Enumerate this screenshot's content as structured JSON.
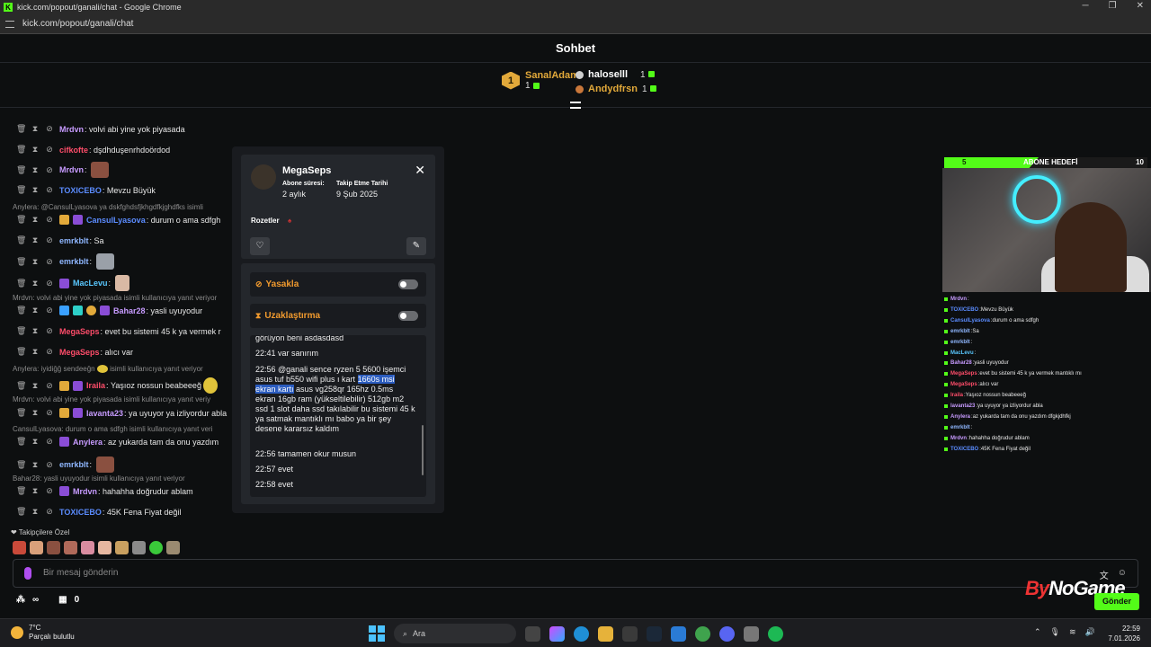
{
  "browser": {
    "window_title": "kick.com/popout/ganali/chat - Google Chrome",
    "url": "kick.com/popout/ganali/chat"
  },
  "chat": {
    "title": "Sohbet",
    "leaderboard": {
      "first": {
        "rank": "1",
        "name": "SanalAdam",
        "count": "1"
      },
      "others": [
        {
          "name": "haloselll",
          "count": "1",
          "color": "#ffffff"
        },
        {
          "name": "Andydfrsn",
          "count": "1",
          "color": "#e2a93a"
        }
      ]
    },
    "messages": [
      {
        "user": "Mrdvn",
        "color": "#c79bff",
        "text": "volvi abi yine yok piyasada"
      },
      {
        "user": "cifkofte",
        "color": "#ff4d6a",
        "text": "dşdhduşenrhdoördod"
      },
      {
        "user": "Mrdvn",
        "color": "#c79bff",
        "text": ""
      },
      {
        "user": "TOXICEBO",
        "color": "#5b8cff",
        "text": "Mevzu Büyük"
      },
      {
        "user": "CansulLyasova",
        "color": "#5b8cff",
        "text": "durum o ama sdfgh"
      },
      {
        "user": "emrkblt",
        "color": "#8fb7ff",
        "text": "Sa"
      },
      {
        "user": "emrkblt",
        "color": "#8fb7ff",
        "text": ""
      },
      {
        "user": "MacLevu",
        "color": "#59c8ff",
        "text": ""
      },
      {
        "user": "Bahar28",
        "color": "#c79bff",
        "text": "yasli uyuyodur"
      },
      {
        "user": "MegaSeps",
        "color": "#ff4d6a",
        "text": "evet bu sistemi 45 k ya vermek r"
      },
      {
        "user": "MegaSeps",
        "color": "#ff4d6a",
        "text": "alıcı var"
      },
      {
        "user": "Iraila",
        "color": "#ff4d6a",
        "text": "Yaşıoz nossun beabeeeğ"
      },
      {
        "user": "lavanta23",
        "color": "#c79bff",
        "text": "ya uyuyor ya izliyordur abla"
      },
      {
        "user": "Anylera",
        "color": "#c79bff",
        "text": "az yukarda tam da onu yazdım"
      },
      {
        "user": "emrkblt",
        "color": "#8fb7ff",
        "text": ""
      },
      {
        "user": "Mrdvn",
        "color": "#c79bff",
        "text": "hahahha doğrudur ablam"
      },
      {
        "user": "TOXICEBO",
        "color": "#5b8cff",
        "text": "45K Fena Fiyat değil"
      }
    ],
    "replies": [
      "Anylera: @CansulLyasova ya dskfghdsfjkhgdfkjghdfks isimli",
      "Mrdvn: volvi abi yine yok piyasada isimli kullanıcıya yanıt veriyor",
      "Anylera: iyidiğğ sendeeğn",
      "isimli kullanıcıya yanıt veriyor",
      "Mrdvn: volvi abi yine yok piyasada isimli kullanıcıya yanıt veriy",
      "CansulLyasova: durum o ama sdfgh isimli kullanıcıya yanıt veri",
      "Bahar28: yasli uyuyodur isimli kullanıcıya yanıt veriyor"
    ],
    "followers_label": "Takipçilere Özel",
    "input_placeholder": "Bir mesaj gönderin",
    "send_label": "Gönder",
    "bottom_count": "0"
  },
  "user_card": {
    "username": "MegaSeps",
    "sub_label": "Abone süresi:",
    "sub_value": "2 aylık",
    "follow_label": "Takip Etme Tarihi",
    "follow_value": "9 Şub 2025",
    "badges_label": "Rozetler",
    "ban_label": "Yasakla",
    "timeout_label": "Uzaklaştırma",
    "history": {
      "top_cut": "görüyon beni asdasdasd",
      "l1": "22:41 var sanırım",
      "l2a": "22:56 @ganali sence ryzen 5 5600 işemci asus tuf b550 wifi plus ı kart ",
      "l2hl": "1660s msi ekran kartı",
      "l2b": " asus vg258qr 165hz 0.5ms ekran 16gb ram (yükseltilebilir) 512gb m2 ssd 1 slot daha ssd takılabilir bu sistemi 45 k ya satmak mantıklı mı babo ya bir şey desene kararsız kaldım",
      "l3": "22:56 tamamen okur musun",
      "l4": "22:57 evet",
      "l5": "22:58 evet"
    }
  },
  "stream_overlay": {
    "goal_start": "5",
    "goal_title": "ABONE HEDEFİ",
    "goal_end": "10",
    "goal_progress": 0.5,
    "brand_a": "By",
    "brand_b": "NoGame",
    "chat": [
      {
        "user": "Mrdvn",
        "color": "#c79bff",
        "text": ""
      },
      {
        "user": "TOXICEBO",
        "color": "#5b8cff",
        "text": "Mevzu Büyük"
      },
      {
        "user": "CansulLyasova",
        "color": "#5b8cff",
        "text": "durum o ama sdfgh"
      },
      {
        "user": "emrkblt",
        "color": "#8fb7ff",
        "text": "Sa"
      },
      {
        "user": "emrkblt",
        "color": "#8fb7ff",
        "text": ""
      },
      {
        "user": "MacLevu",
        "color": "#59c8ff",
        "text": ""
      },
      {
        "user": "Bahar28",
        "color": "#c79bff",
        "text": "yasli uyuyodur"
      },
      {
        "user": "MegaSeps",
        "color": "#ff4d6a",
        "text": "evet bu sistemi 45 k ya vermek mantıklı mı"
      },
      {
        "user": "MegaSeps",
        "color": "#ff4d6a",
        "text": "alıcı var"
      },
      {
        "user": "Iraila",
        "color": "#ff4d6a",
        "text": "Yaşıoz nossun beabeeeğ"
      },
      {
        "user": "lavanta23",
        "color": "#c79bff",
        "text": "ya uyuyor ya izliyordur abla"
      },
      {
        "user": "Anylera",
        "color": "#c79bff",
        "text": "az yukarda tam da onu yazdım dfgkjdhfkj"
      },
      {
        "user": "emrkblt",
        "color": "#8fb7ff",
        "text": ""
      },
      {
        "user": "Mrdvn",
        "color": "#c79bff",
        "text": "hahahha doğrudur ablam"
      },
      {
        "user": "TOXICEBO",
        "color": "#5b8cff",
        "text": "45K Fena Fiyat değil"
      }
    ]
  },
  "taskbar": {
    "temp": "7°C",
    "weather": "Parçalı bulutlu",
    "search": "Ara",
    "time": "22:59",
    "date": "7.01.2026"
  }
}
